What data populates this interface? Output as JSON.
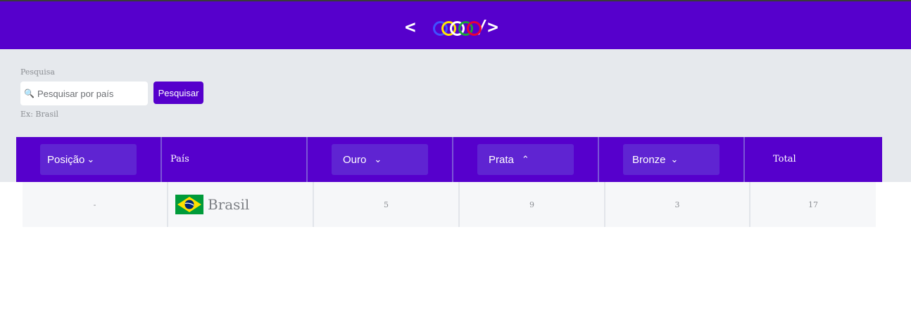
{
  "header": {
    "logo_left": "<",
    "logo_right": "/>",
    "ring_colors": [
      "#3f51ff",
      "#ffe600",
      "#ffffff",
      "#1aa33a",
      "#e6003a"
    ],
    "background": "#5600cc"
  },
  "search": {
    "label": "Pesquisa",
    "placeholder": "Pesquisar por país",
    "value": "",
    "button_label": "Pesquisar",
    "hint": "Ex: Brasil",
    "icon": "magnifier-icon"
  },
  "table": {
    "columns": [
      {
        "label": "Posição",
        "sortable": true,
        "arrow": "⌄"
      },
      {
        "label": "País",
        "sortable": false
      },
      {
        "label": "Ouro",
        "sortable": true,
        "arrow": "⌄"
      },
      {
        "label": "Prata",
        "sortable": true,
        "arrow": "⌃"
      },
      {
        "label": "Bronze",
        "sortable": true,
        "arrow": "⌄"
      },
      {
        "label": "Total",
        "sortable": false
      }
    ],
    "rows": [
      {
        "position": "-",
        "country": "Brasil",
        "flag": "brazil-flag",
        "gold": "5",
        "silver": "9",
        "bronze": "3",
        "total": "17"
      }
    ]
  },
  "colors": {
    "accent": "#5600cc",
    "band": "#e6e9ed",
    "row": "#f6f7f9"
  }
}
